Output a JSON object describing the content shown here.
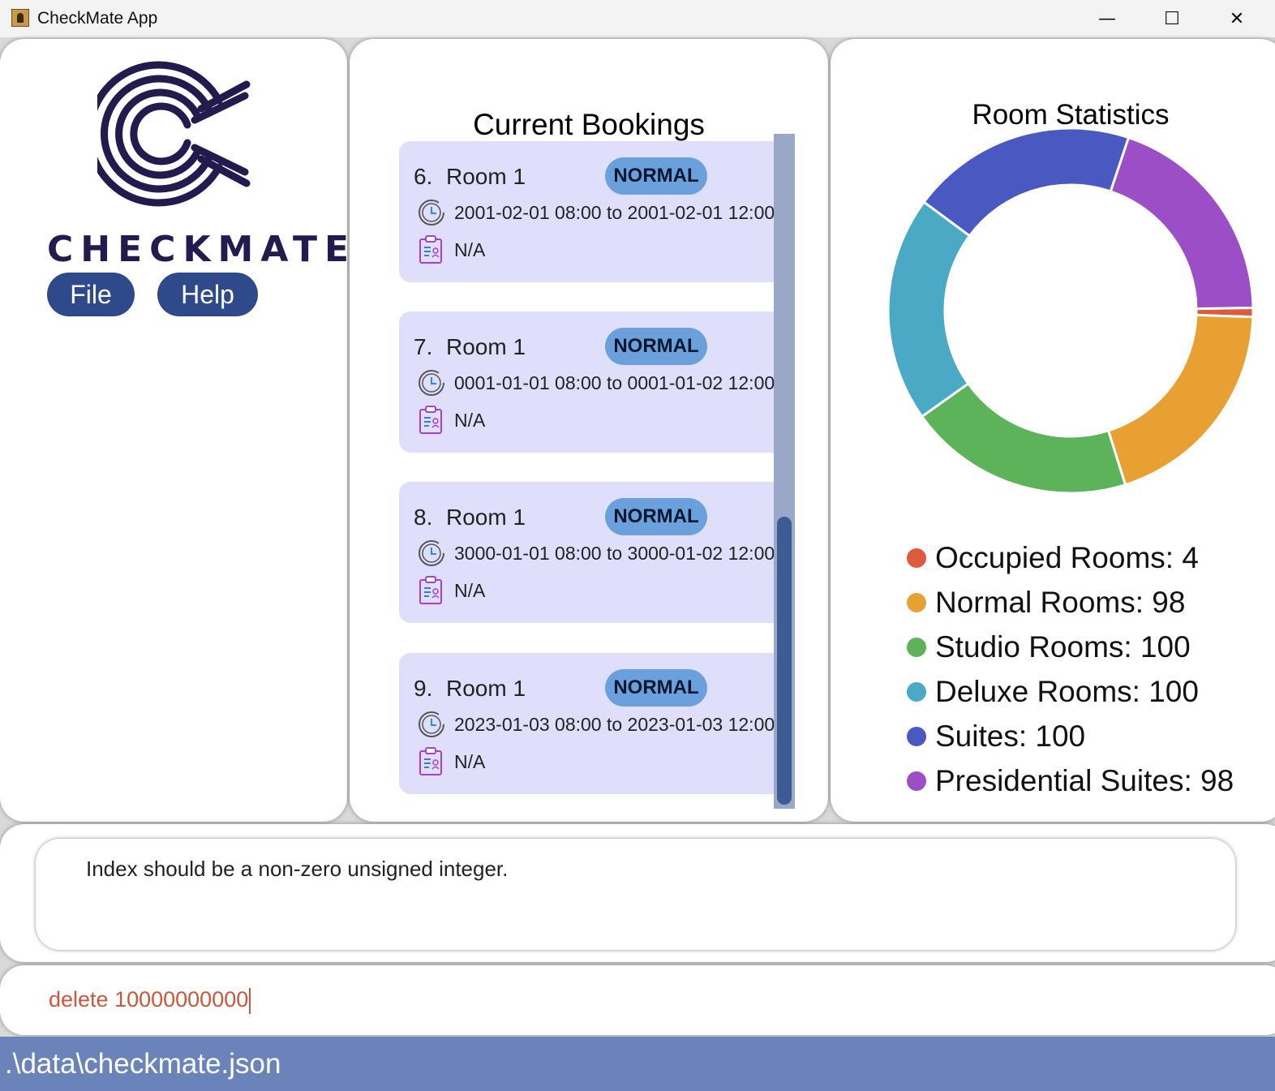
{
  "window": {
    "title": "CheckMate App",
    "minimize_glyph": "—",
    "maximize_glyph": "☐",
    "close_glyph": "✕"
  },
  "sidebar": {
    "brand": "CHECKMATE",
    "menu": [
      {
        "label": "File"
      },
      {
        "label": "Help"
      }
    ]
  },
  "bookings": {
    "title": "Current Bookings",
    "items": [
      {
        "index": "6.",
        "room": "Room 1",
        "type": "NORMAL",
        "period": "2001-02-01 08:00 to 2001-02-01 12:00",
        "remark": "N/A"
      },
      {
        "index": "7.",
        "room": "Room 1",
        "type": "NORMAL",
        "period": "0001-01-01 08:00 to 0001-01-02 12:00",
        "remark": "N/A"
      },
      {
        "index": "8.",
        "room": "Room 1",
        "type": "NORMAL",
        "period": "3000-01-01 08:00 to 3000-01-02 12:00",
        "remark": "N/A"
      },
      {
        "index": "9.",
        "room": "Room 1",
        "type": "NORMAL",
        "period": "2023-01-03 08:00 to 2023-01-03 12:00",
        "remark": "N/A"
      }
    ]
  },
  "stats": {
    "title": "Room Statistics",
    "legend": [
      {
        "label": "Occupied Rooms: 4",
        "color": "#de5a3c"
      },
      {
        "label": "Normal Rooms: 98",
        "color": "#e9a033"
      },
      {
        "label": "Studio Rooms: 100",
        "color": "#5cb35a"
      },
      {
        "label": "Deluxe Rooms: 100",
        "color": "#4aaac5"
      },
      {
        "label": "Suites: 100",
        "color": "#4a58c2"
      },
      {
        "label": "Presidential Suites: 98",
        "color": "#9c4ec6"
      }
    ]
  },
  "chart_data": {
    "type": "pie",
    "categories": [
      "Occupied Rooms",
      "Normal Rooms",
      "Studio Rooms",
      "Deluxe Rooms",
      "Suites",
      "Presidential Suites"
    ],
    "values": [
      4,
      98,
      100,
      100,
      100,
      98
    ],
    "colors": [
      "#de5a3c",
      "#e9a033",
      "#5cb35a",
      "#4aaac5",
      "#4a58c2",
      "#9c4ec6"
    ],
    "title": "Room Statistics",
    "donut": true,
    "legend": "bottom"
  },
  "result": {
    "message": "Index should be a non-zero unsigned integer."
  },
  "command": {
    "value": "delete 10000000000"
  },
  "status": {
    "file_path": ".\\data\\checkmate.json"
  }
}
